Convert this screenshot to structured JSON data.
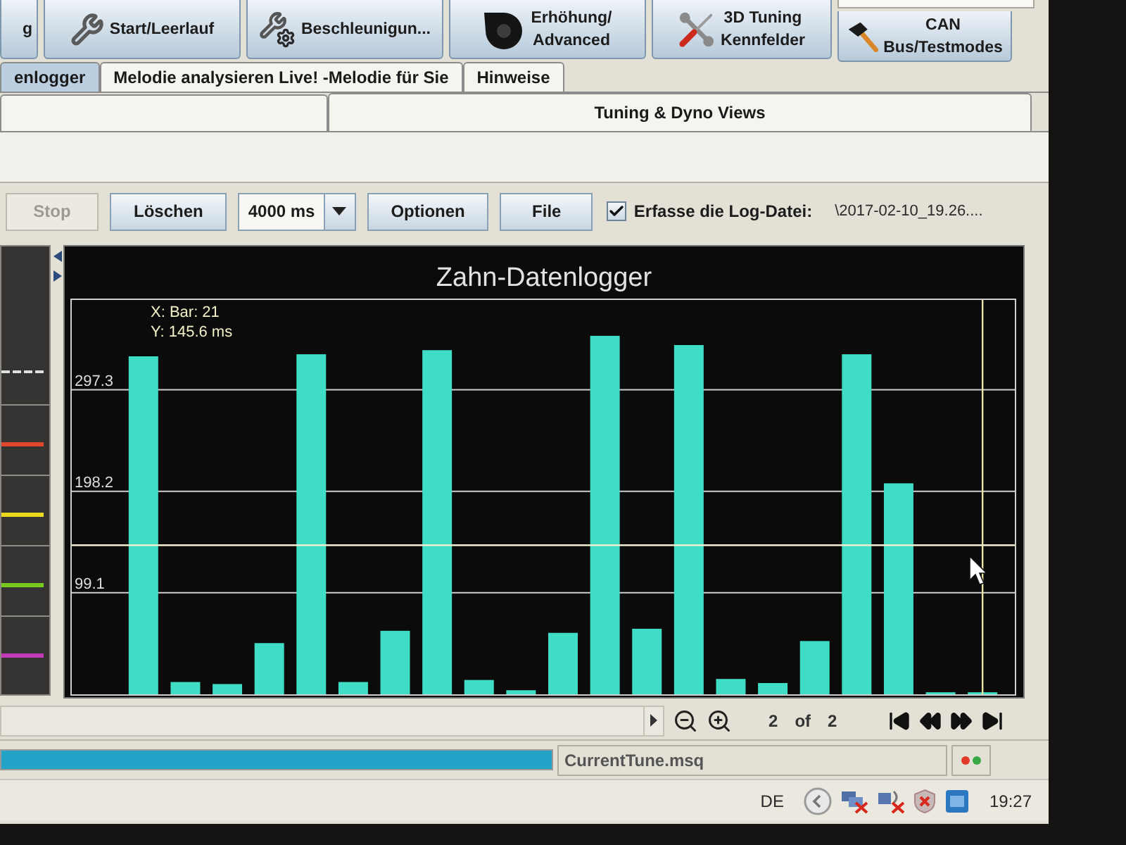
{
  "toolbar": {
    "buttons": [
      {
        "lines": [
          "g"
        ]
      },
      {
        "lines": [
          "Start/Leerlauf"
        ]
      },
      {
        "lines": [
          "Beschleunigun..."
        ]
      },
      {
        "lines": [
          "Erhöhung/",
          "Advanced"
        ]
      },
      {
        "lines": [
          "3D Tuning",
          "Kennfelder"
        ]
      },
      {
        "lines": [
          "CAN",
          "Bus/Testmodes"
        ]
      }
    ]
  },
  "tabs": [
    {
      "label": "enlogger",
      "selected": true
    },
    {
      "label": "Melodie analysieren Live! -Melodie für Sie",
      "selected": false
    },
    {
      "label": "Hinweise",
      "selected": false
    }
  ],
  "tabs_row_2": [
    {
      "label": "Tuning & Dyno Views",
      "selected": false
    }
  ],
  "logger_toolbar": [
    {
      "kind": "button",
      "label": "Stop",
      "disabled": true
    },
    {
      "kind": "button",
      "label": "Löschen",
      "disabled": false
    },
    {
      "kind": "combo",
      "value": "4000 ms"
    },
    {
      "kind": "button",
      "label": "Optionen",
      "disabled": false
    },
    {
      "kind": "button",
      "label": "File",
      "disabled": false
    },
    {
      "kind": "checkbox",
      "label": "Erfasse die Log-Datei:",
      "checked": true
    },
    {
      "kind": "text",
      "text": "\\2017-02-10_19.26...."
    }
  ],
  "legend": {
    "traces": [
      {
        "color": "#dcdcdc",
        "dashed": true
      },
      {
        "color": "#e0462c",
        "dashed": false
      },
      {
        "color": "#ecd81c",
        "dashed": false
      },
      {
        "color": "#78c81e",
        "dashed": false
      },
      {
        "color": "#c23ab8",
        "dashed": false
      }
    ]
  },
  "chart": {
    "x_readout": "X: Bar: 21",
    "chart_data": {
      "type": "bar",
      "title": "Zahn-Datenlogger",
      "values": [
        330,
        12,
        10,
        50,
        332,
        12,
        62,
        336,
        14,
        4,
        60,
        350,
        64,
        341,
        15,
        11,
        52,
        332,
        206,
        2,
        2
      ],
      "ylim": [
        0,
        385
      ],
      "yticks": [
        {
          "value": 99.1,
          "label": "99.1"
        },
        {
          "value": 198.2,
          "label": "198.2"
        },
        {
          "value": 297.3,
          "label": "297.3"
        }
      ],
      "grid": true,
      "ref_lines": [
        {
          "axis": "y",
          "value": 145.6,
          "label": "Y: 145.6 ms"
        }
      ]
    }
  },
  "pager": {
    "current": "2",
    "separator": "of",
    "total": "2"
  },
  "status_bar": {
    "progress": {
      "level": 1
    },
    "file": "CurrentTune.msq",
    "indicators": [
      {
        "color": "#e23a2a"
      },
      {
        "color": "#3aa845"
      }
    ]
  },
  "taskbar": {
    "language": "DE",
    "clock": "19:27"
  }
}
